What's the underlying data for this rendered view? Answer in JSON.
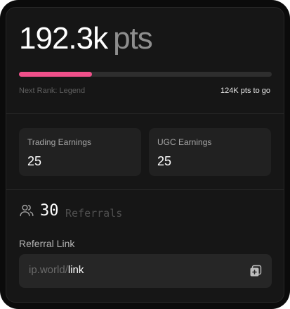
{
  "points": {
    "value": "192.3k",
    "unit": "pts"
  },
  "rank": {
    "progress": 0.29,
    "next_rank_label": "Next Rank: Legend",
    "remaining_label": "124K pts to go",
    "accent_color": "#f0508a"
  },
  "stats": [
    {
      "label": "Trading Earnings",
      "value": "25"
    },
    {
      "label": "UGC Earnings",
      "value": "25"
    }
  ],
  "referrals": {
    "icon": "users-icon",
    "count": "30",
    "label": "Referrals"
  },
  "referral_link": {
    "title": "Referral Link",
    "prefix": "ip.world/",
    "path": "link",
    "copy_icon": "copy-icon"
  }
}
